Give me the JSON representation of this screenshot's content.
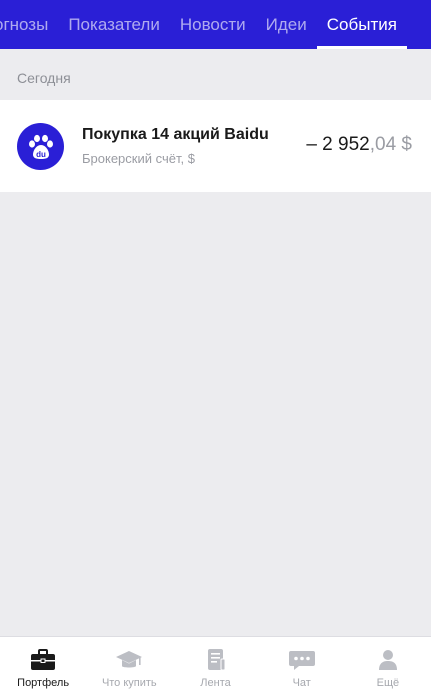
{
  "tabs": [
    {
      "label": "огнозы"
    },
    {
      "label": "Показатели"
    },
    {
      "label": "Новости"
    },
    {
      "label": "Идеи"
    },
    {
      "label": "События",
      "active": true
    }
  ],
  "section": {
    "label": "Сегодня"
  },
  "event": {
    "logo_icon": "baidu-logo",
    "logo_text": "du",
    "title": "Покупка 14 акций Baidu",
    "subtitle": "Брокерский счёт, $",
    "amount_main": "– 2 952",
    "amount_frac": ",04 $"
  },
  "bottom_nav": [
    {
      "label": "Портфель",
      "icon": "briefcase-icon",
      "active": true
    },
    {
      "label": "Что купить",
      "icon": "graduation-cap-icon"
    },
    {
      "label": "Лента",
      "icon": "feed-icon"
    },
    {
      "label": "Чат",
      "icon": "chat-icon"
    },
    {
      "label": "Ещё",
      "icon": "person-icon"
    }
  ],
  "colors": {
    "brand": "#2a1fd6",
    "background": "#ececef",
    "muted": "#a6a8ae"
  }
}
